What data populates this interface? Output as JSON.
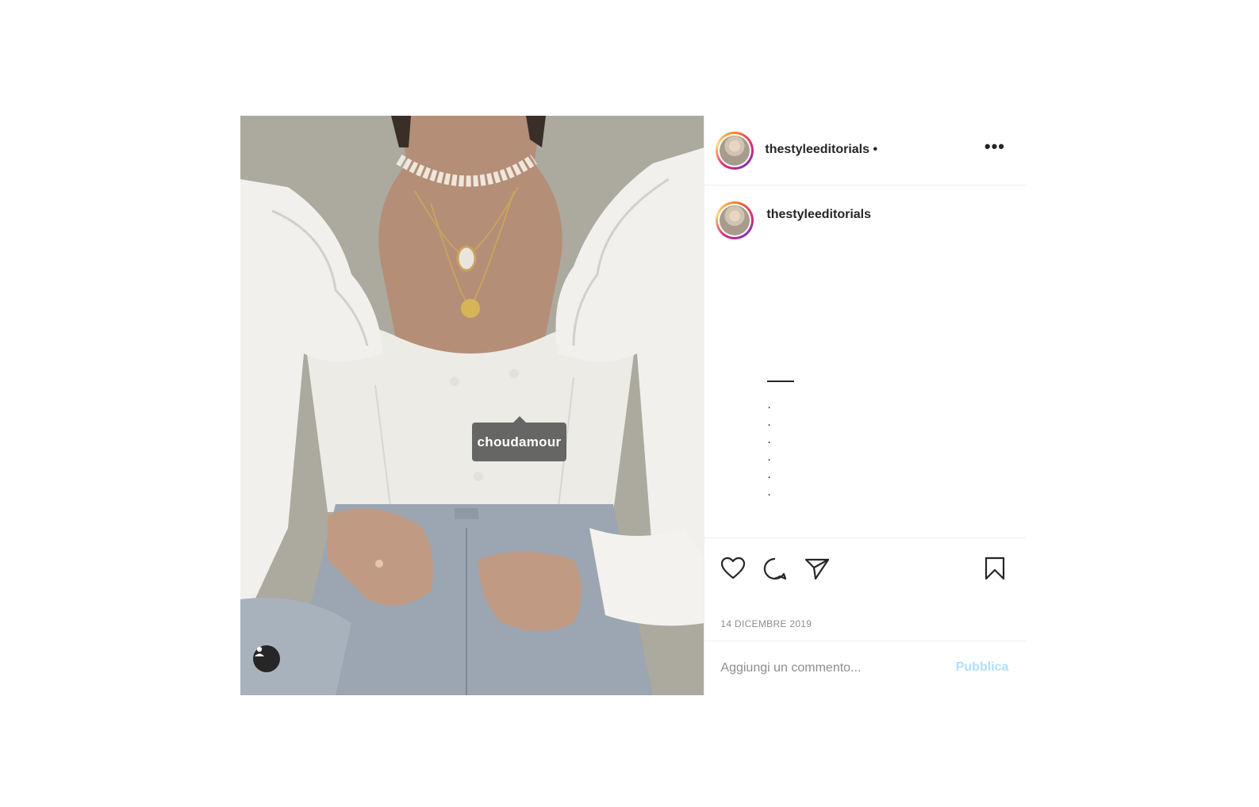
{
  "post": {
    "author": "thestyleeditorials",
    "author_follow_dot": "•",
    "more_label": "•••",
    "photo_tag": "choudamour",
    "caption": {
      "author": "thestyleeditorials",
      "lines": [
        ".",
        ".",
        ".",
        ".",
        ".",
        "."
      ]
    },
    "date": "14 DICEMBRE 2019",
    "comment_placeholder": "Aggiungi un commento...",
    "publish_label": "Pubblica"
  },
  "icons": {
    "like": "heart-icon",
    "comment": "comment-icon",
    "share": "paper-plane-icon",
    "save": "bookmark-icon",
    "tagged_users": "user-icon"
  },
  "colors": {
    "text": "#262626",
    "muted": "#8e8e8e",
    "divider": "#efefef",
    "publish_disabled": "#b2dffc"
  }
}
